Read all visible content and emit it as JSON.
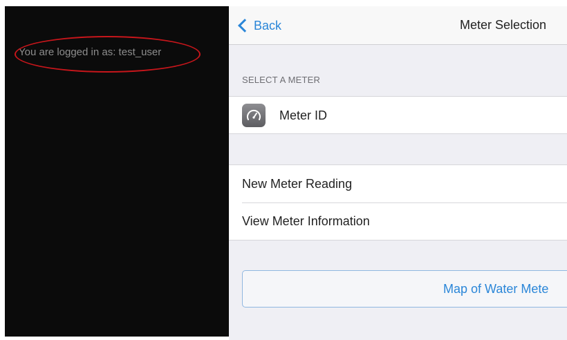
{
  "left_panel": {
    "login_status": "You are logged in as: test_user"
  },
  "navbar": {
    "back_label": "Back",
    "title": "Meter Selection"
  },
  "meter_section": {
    "header": "SELECT A METER",
    "meter_icon": "gauge-icon",
    "meter_label": "Meter ID"
  },
  "actions": {
    "items": [
      {
        "label": "New Meter Reading"
      },
      {
        "label": "View Meter Information"
      }
    ]
  },
  "map_button": {
    "label": "Map of Water Mete"
  },
  "colors": {
    "accent": "#2a86d8",
    "annotation_red": "#c8161b",
    "left_background": "#0b0b0b",
    "grouped_background": "#efeff4"
  }
}
